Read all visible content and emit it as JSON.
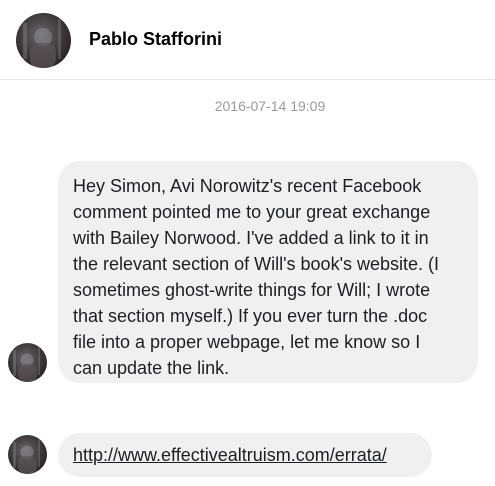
{
  "header": {
    "contact_name": "Pablo Stafforini"
  },
  "conversation": {
    "timestamp": "2016-07-14 19:09",
    "messages": [
      {
        "lines": [
          "Hey Simon, Avi Norowitz's recent Facebook",
          "comment pointed me to your great exchange",
          "with Bailey Norwood. I've added a link to it in",
          "the relevant section of Will's book's website. (I",
          "sometimes ghost-write things for Will; I wrote",
          "that section myself.) If you ever turn the .doc",
          "file into a proper webpage, let me know so I",
          "can update the link."
        ]
      },
      {
        "link": "http://www.effectivealtruism.com/errata/"
      }
    ]
  },
  "colors": {
    "bubble_bg": "#f0f0f0",
    "timestamp": "#9a9a9a",
    "text": "#1c1e21"
  }
}
